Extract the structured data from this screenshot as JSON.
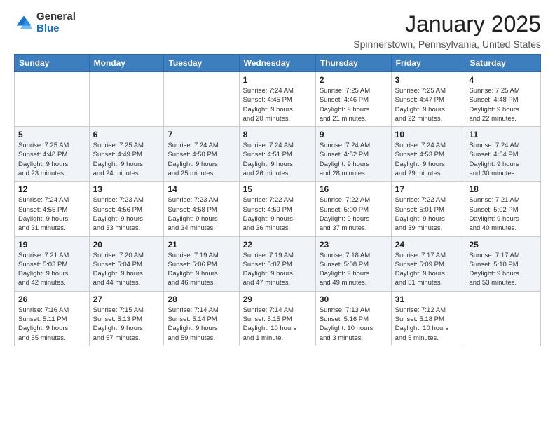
{
  "logo": {
    "general": "General",
    "blue": "Blue"
  },
  "title": "January 2025",
  "location": "Spinnerstown, Pennsylvania, United States",
  "weekdays": [
    "Sunday",
    "Monday",
    "Tuesday",
    "Wednesday",
    "Thursday",
    "Friday",
    "Saturday"
  ],
  "weeks": [
    [
      {
        "day": "",
        "info": ""
      },
      {
        "day": "",
        "info": ""
      },
      {
        "day": "",
        "info": ""
      },
      {
        "day": "1",
        "info": "Sunrise: 7:24 AM\nSunset: 4:45 PM\nDaylight: 9 hours\nand 20 minutes."
      },
      {
        "day": "2",
        "info": "Sunrise: 7:25 AM\nSunset: 4:46 PM\nDaylight: 9 hours\nand 21 minutes."
      },
      {
        "day": "3",
        "info": "Sunrise: 7:25 AM\nSunset: 4:47 PM\nDaylight: 9 hours\nand 22 minutes."
      },
      {
        "day": "4",
        "info": "Sunrise: 7:25 AM\nSunset: 4:48 PM\nDaylight: 9 hours\nand 22 minutes."
      }
    ],
    [
      {
        "day": "5",
        "info": "Sunrise: 7:25 AM\nSunset: 4:48 PM\nDaylight: 9 hours\nand 23 minutes."
      },
      {
        "day": "6",
        "info": "Sunrise: 7:25 AM\nSunset: 4:49 PM\nDaylight: 9 hours\nand 24 minutes."
      },
      {
        "day": "7",
        "info": "Sunrise: 7:24 AM\nSunset: 4:50 PM\nDaylight: 9 hours\nand 25 minutes."
      },
      {
        "day": "8",
        "info": "Sunrise: 7:24 AM\nSunset: 4:51 PM\nDaylight: 9 hours\nand 26 minutes."
      },
      {
        "day": "9",
        "info": "Sunrise: 7:24 AM\nSunset: 4:52 PM\nDaylight: 9 hours\nand 28 minutes."
      },
      {
        "day": "10",
        "info": "Sunrise: 7:24 AM\nSunset: 4:53 PM\nDaylight: 9 hours\nand 29 minutes."
      },
      {
        "day": "11",
        "info": "Sunrise: 7:24 AM\nSunset: 4:54 PM\nDaylight: 9 hours\nand 30 minutes."
      }
    ],
    [
      {
        "day": "12",
        "info": "Sunrise: 7:24 AM\nSunset: 4:55 PM\nDaylight: 9 hours\nand 31 minutes."
      },
      {
        "day": "13",
        "info": "Sunrise: 7:23 AM\nSunset: 4:56 PM\nDaylight: 9 hours\nand 33 minutes."
      },
      {
        "day": "14",
        "info": "Sunrise: 7:23 AM\nSunset: 4:58 PM\nDaylight: 9 hours\nand 34 minutes."
      },
      {
        "day": "15",
        "info": "Sunrise: 7:22 AM\nSunset: 4:59 PM\nDaylight: 9 hours\nand 36 minutes."
      },
      {
        "day": "16",
        "info": "Sunrise: 7:22 AM\nSunset: 5:00 PM\nDaylight: 9 hours\nand 37 minutes."
      },
      {
        "day": "17",
        "info": "Sunrise: 7:22 AM\nSunset: 5:01 PM\nDaylight: 9 hours\nand 39 minutes."
      },
      {
        "day": "18",
        "info": "Sunrise: 7:21 AM\nSunset: 5:02 PM\nDaylight: 9 hours\nand 40 minutes."
      }
    ],
    [
      {
        "day": "19",
        "info": "Sunrise: 7:21 AM\nSunset: 5:03 PM\nDaylight: 9 hours\nand 42 minutes."
      },
      {
        "day": "20",
        "info": "Sunrise: 7:20 AM\nSunset: 5:04 PM\nDaylight: 9 hours\nand 44 minutes."
      },
      {
        "day": "21",
        "info": "Sunrise: 7:19 AM\nSunset: 5:06 PM\nDaylight: 9 hours\nand 46 minutes."
      },
      {
        "day": "22",
        "info": "Sunrise: 7:19 AM\nSunset: 5:07 PM\nDaylight: 9 hours\nand 47 minutes."
      },
      {
        "day": "23",
        "info": "Sunrise: 7:18 AM\nSunset: 5:08 PM\nDaylight: 9 hours\nand 49 minutes."
      },
      {
        "day": "24",
        "info": "Sunrise: 7:17 AM\nSunset: 5:09 PM\nDaylight: 9 hours\nand 51 minutes."
      },
      {
        "day": "25",
        "info": "Sunrise: 7:17 AM\nSunset: 5:10 PM\nDaylight: 9 hours\nand 53 minutes."
      }
    ],
    [
      {
        "day": "26",
        "info": "Sunrise: 7:16 AM\nSunset: 5:11 PM\nDaylight: 9 hours\nand 55 minutes."
      },
      {
        "day": "27",
        "info": "Sunrise: 7:15 AM\nSunset: 5:13 PM\nDaylight: 9 hours\nand 57 minutes."
      },
      {
        "day": "28",
        "info": "Sunrise: 7:14 AM\nSunset: 5:14 PM\nDaylight: 9 hours\nand 59 minutes."
      },
      {
        "day": "29",
        "info": "Sunrise: 7:14 AM\nSunset: 5:15 PM\nDaylight: 10 hours\nand 1 minute."
      },
      {
        "day": "30",
        "info": "Sunrise: 7:13 AM\nSunset: 5:16 PM\nDaylight: 10 hours\nand 3 minutes."
      },
      {
        "day": "31",
        "info": "Sunrise: 7:12 AM\nSunset: 5:18 PM\nDaylight: 10 hours\nand 5 minutes."
      },
      {
        "day": "",
        "info": ""
      }
    ]
  ]
}
